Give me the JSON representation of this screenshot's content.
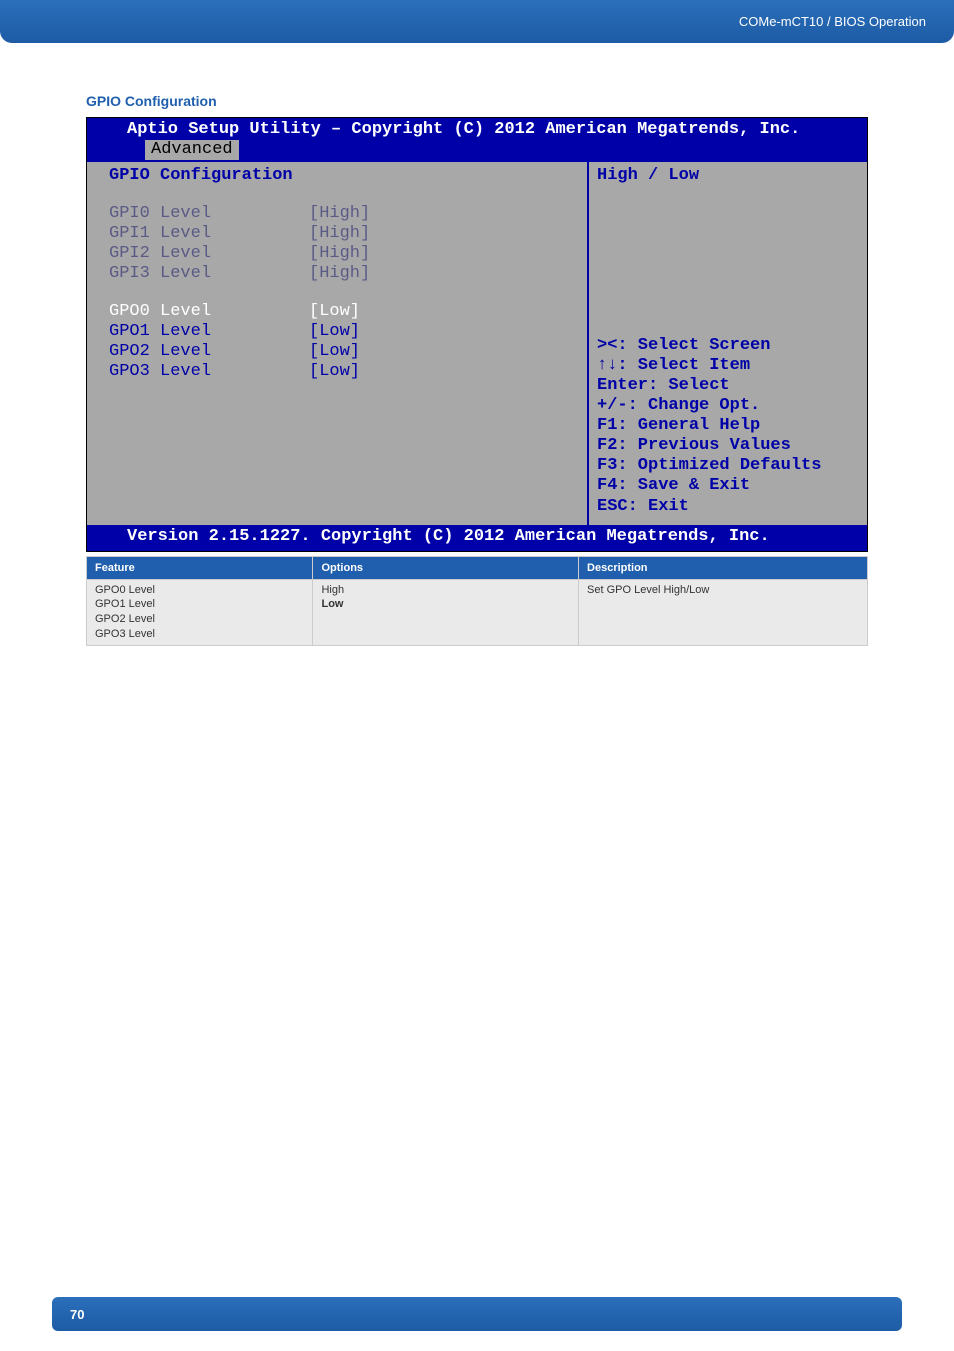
{
  "header": {
    "breadcrumb": "COMe-mCT10 / BIOS Operation"
  },
  "section": {
    "title": "GPIO Configuration"
  },
  "bios": {
    "title": "Aptio Setup Utility – Copyright (C) 2012 American Megatrends, Inc.",
    "tab": "Advanced",
    "heading": "GPIO Configuration",
    "gpi": [
      {
        "label": "GPI0 Level",
        "value": "[High]"
      },
      {
        "label": "GPI1 Level",
        "value": "[High]"
      },
      {
        "label": "GPI2 Level",
        "value": "[High]"
      },
      {
        "label": "GPI3 Level",
        "value": "[High]"
      }
    ],
    "gpo": [
      {
        "label": "GPO0 Level",
        "value": "[Low]",
        "sel": true
      },
      {
        "label": "GPO1 Level",
        "value": "[Low]"
      },
      {
        "label": "GPO2 Level",
        "value": "[Low]"
      },
      {
        "label": "GPO3 Level",
        "value": "[Low]"
      }
    ],
    "item_help": "High / Low",
    "help_keys": {
      "l1": "><: Select Screen",
      "l2": "↑↓: Select Item",
      "l3": "Enter: Select",
      "l4": "+/-: Change Opt.",
      "l5": "F1: General Help",
      "l6": "F2: Previous Values",
      "l7": "F3: Optimized Defaults",
      "l8": "F4: Save & Exit",
      "l9": "ESC: Exit"
    },
    "footer": "Version 2.15.1227. Copyright (C) 2012 American Megatrends, Inc."
  },
  "table": {
    "headers": {
      "feature": "Feature",
      "options": "Options",
      "description": "Description"
    },
    "row": {
      "feature_l1": "GPO0 Level",
      "feature_l2": "GPO1 Level",
      "feature_l3": "GPO2 Level",
      "feature_l4": "GPO3 Level",
      "options_l1": "High",
      "options_l2": "Low",
      "description": "Set GPO Level High/Low"
    }
  },
  "footer": {
    "page": "70"
  }
}
